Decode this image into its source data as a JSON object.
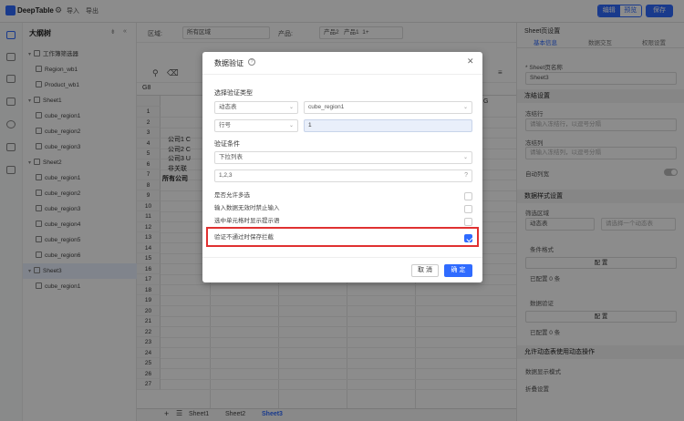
{
  "app": {
    "name": "DeepTable",
    "import_label": "导入",
    "export_label": "导出",
    "mode_edit": "编辑",
    "mode_preview": "预览",
    "save_label": "保存"
  },
  "tree": {
    "title": "大纲树",
    "rows": [
      {
        "label": "工作簿筛选器",
        "level": 0,
        "expanded": true
      },
      {
        "label": "Region_wb1",
        "level": 1
      },
      {
        "label": "Product_wb1",
        "level": 1
      },
      {
        "label": "Sheet1",
        "level": 0,
        "expanded": true
      },
      {
        "label": "cube_region1",
        "level": 1
      },
      {
        "label": "cube_region2",
        "level": 1
      },
      {
        "label": "cube_region3",
        "level": 1
      },
      {
        "label": "Sheet2",
        "level": 0,
        "expanded": true
      },
      {
        "label": "cube_region1",
        "level": 1
      },
      {
        "label": "cube_region2",
        "level": 1
      },
      {
        "label": "cube_region3",
        "level": 1
      },
      {
        "label": "cube_region4",
        "level": 1
      },
      {
        "label": "cube_region5",
        "level": 1
      },
      {
        "label": "cube_region6",
        "level": 1
      },
      {
        "label": "Sheet3",
        "level": 0,
        "expanded": true,
        "selected": true
      },
      {
        "label": "cube_region1",
        "level": 1
      }
    ]
  },
  "filters": {
    "region_label": "区域:",
    "region_value": "所有区域",
    "product_label": "产品:",
    "product_chip1": "产品2",
    "product_chip2": "产品1",
    "product_more": "1+"
  },
  "sheet": {
    "cell_ref": "G8",
    "col_g": "G",
    "row_numbers": [
      "1",
      "2",
      "3",
      "4",
      "5",
      "6",
      "7",
      "8",
      "9",
      "10",
      "11",
      "12",
      "13",
      "14",
      "15",
      "16",
      "17",
      "18",
      "19",
      "20",
      "21",
      "22",
      "23",
      "24",
      "25",
      "26",
      "27"
    ],
    "cells": {
      "r3": "公司1 C",
      "r4": "公司2 C",
      "r5": "公司3 U",
      "r6": "非关联",
      "r7": "所有公司"
    },
    "tabs": [
      "Sheet1",
      "Sheet2",
      "Sheet3"
    ]
  },
  "panel": {
    "title": "Sheet页设置",
    "tabs": [
      "基本信息",
      "数据交互",
      "权限设置"
    ],
    "sheet_name_label": "* Sheet页名称",
    "sheet_name_value": "Sheet3",
    "freeze_section": "冻结设置",
    "freeze_row_label": "冻结行",
    "freeze_row_placeholder": "请输入冻结行，以逗号分隔",
    "freeze_col_label": "冻结列",
    "freeze_col_placeholder": "请输入冻结列，以逗号分隔",
    "autowidth_label": "自动列宽",
    "style_section": "数据样式设置",
    "filter_area_label": "筛选区域",
    "filter_area_value": "动态表",
    "filter_area_placeholder": "请选择一个动态表",
    "cond_format_label": "条件格式",
    "config_label": "配 置",
    "configured_count": "已配置 0 条",
    "data_validation_label": "数据验证",
    "config_label2": "配 置",
    "configured_count2": "已配置 0 条",
    "allow_section": "允许动态表使用动态操作",
    "display_mode_label": "数据显示模式",
    "collapse_label": "折叠设置"
  },
  "modal": {
    "title": "数据验证",
    "section_type": "选择验证类型",
    "type_value": "动态表",
    "table_value": "cube_region1",
    "field_value": "行号",
    "field_input": "1",
    "section_condition": "验证条件",
    "condition_value": "下拉列表",
    "list_value": "1,2,3",
    "opt_multi": "是否允许多选",
    "opt_forbid": "输入数据无效时禁止输入",
    "opt_tip": "选中单元格时显示提示语",
    "opt_block": "验证不通过时保存拦截",
    "cancel_label": "取 消",
    "ok_label": "确 定"
  },
  "colors": {
    "accent": "#2f6bff",
    "highlight": "#e03131"
  }
}
